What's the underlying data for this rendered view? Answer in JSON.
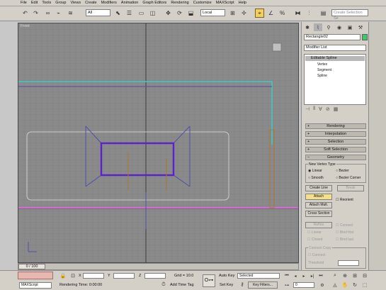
{
  "menu": [
    "File",
    "Edit",
    "Tools",
    "Group",
    "Views",
    "Create",
    "Modifiers",
    "Animation",
    "Graph Editors",
    "Rendering",
    "Customize",
    "MAXScript",
    "Help"
  ],
  "toolbar": {
    "filter_value": "All",
    "coord_value": "Local",
    "selection_set_placeholder": "Create Selection Se"
  },
  "viewport": {
    "label": "Front"
  },
  "command_panel": {
    "object_name": "Rectangle02",
    "modifier_list": "Modifier List",
    "stack": [
      "Editable Spline",
      "Vertex",
      "Segment",
      "Spline"
    ],
    "rollouts": [
      "Rendering",
      "Interpolation",
      "Selection",
      "Soft Selection",
      "Geometry"
    ],
    "new_vertex_type": {
      "title": "New Vertex Type",
      "options": [
        "Linear",
        "Bezier",
        "Smooth",
        "Bezier Corner"
      ]
    },
    "buttons": {
      "create_line": "Create Line",
      "break": "Break",
      "attach": "Attach",
      "reorient": "Reorient",
      "attach_mult": "Attach Mult.",
      "cross_section": "Cross Section",
      "refine": "Refine",
      "connect": "Connect",
      "linear": "Linear",
      "bind_first": "Bind first",
      "closed": "Closed",
      "bind_last": "Bind last"
    },
    "connect_copy": {
      "title": "Connect Copy",
      "connect": "Connect",
      "threshold": "Threshold"
    }
  },
  "timeline": {
    "frame": "0 / 100"
  },
  "status": {
    "x_label": "X",
    "y_label": "Y",
    "z_label": "Z",
    "grid": "Grid = 10.0",
    "auto_key": "Auto Key",
    "selected": "Selected",
    "set_key": "Set Key",
    "key_filters": "Key Filters...",
    "add_time_tag": "Add Time Tag",
    "rendering_time": "Rendering Time: 0:00:00",
    "script_listener": "MAXScript",
    "frame_value": "0"
  },
  "colors": {
    "viewport_bg": "#8a8a8a",
    "cyan_line": "#3fc7c7",
    "magenta_line": "#d46ad4",
    "selected_rect": "#5a22c8",
    "attach_btn": "#f5e08a"
  }
}
